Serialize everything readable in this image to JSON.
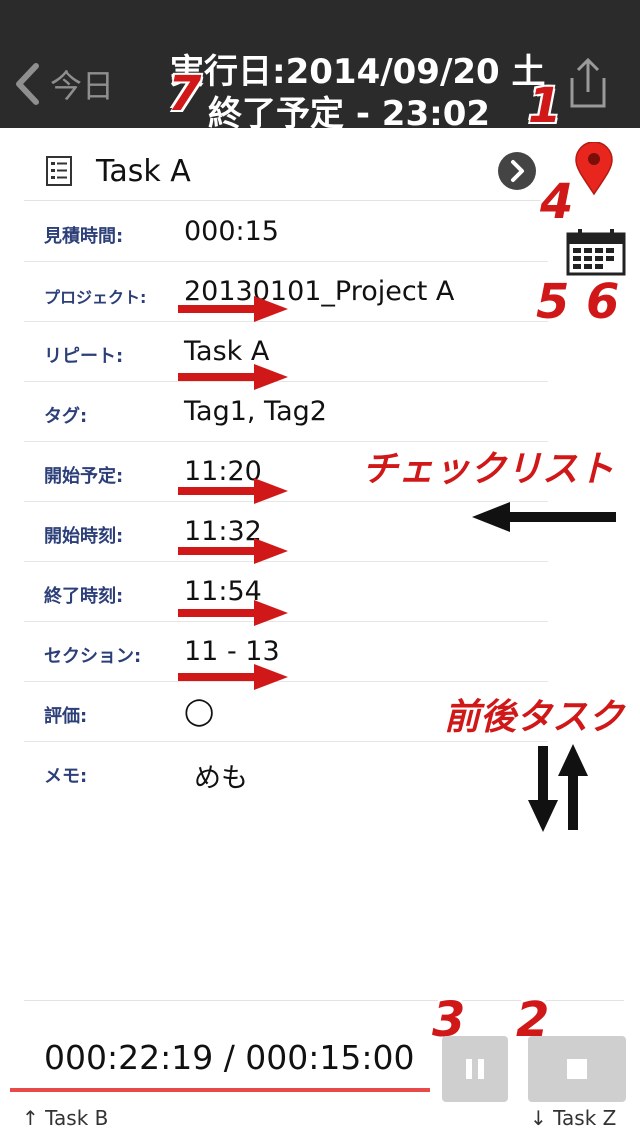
{
  "header": {
    "back_label": "今日",
    "execution_date": "実行日:2014/09/20 土",
    "end_schedule": "終了予定 - 23:02"
  },
  "task": {
    "name": "Task A"
  },
  "fields": [
    {
      "label": "見積時間:",
      "value": "000:15"
    },
    {
      "label": "プロジェクト:",
      "value": "20130101_Project A"
    },
    {
      "label": "リピート:",
      "value": "Task A"
    },
    {
      "label": "タグ:",
      "value": "Tag1, Tag2"
    },
    {
      "label": "開始予定:",
      "value": "11:20"
    },
    {
      "label": "開始時刻:",
      "value": "11:32"
    },
    {
      "label": "終了時刻:",
      "value": "11:54"
    },
    {
      "label": "セクション:",
      "value": "11 - 13"
    },
    {
      "label": "評価:",
      "value": "◯"
    },
    {
      "label": "メモ:",
      "value": "めも"
    }
  ],
  "annotations": {
    "n1": "1",
    "n2": "2",
    "n3": "3",
    "n4": "4",
    "n5": "5",
    "n6": "6",
    "n7": "7",
    "checklist": "チェックリスト",
    "prev_next": "前後タスク"
  },
  "timer": {
    "text": "000:22:19 / 000:15:00",
    "progress": 1.0
  },
  "nav": {
    "prev": "↑ Task B",
    "next": "↓ Task Z"
  },
  "colors": {
    "header_bg": "#2b2b2b",
    "label_color": "#2c3f78",
    "annotation_red": "#d01818",
    "progress_red": "#e84a4a",
    "button_gray": "#cfcfcf"
  },
  "icons": {
    "back": "chevron-left-icon",
    "share": "share-icon",
    "task": "list-icon",
    "go": "chevron-right-circle-icon",
    "pin": "map-pin-icon",
    "calendar": "calendar-icon",
    "pause": "pause-icon",
    "stop": "stop-icon"
  }
}
